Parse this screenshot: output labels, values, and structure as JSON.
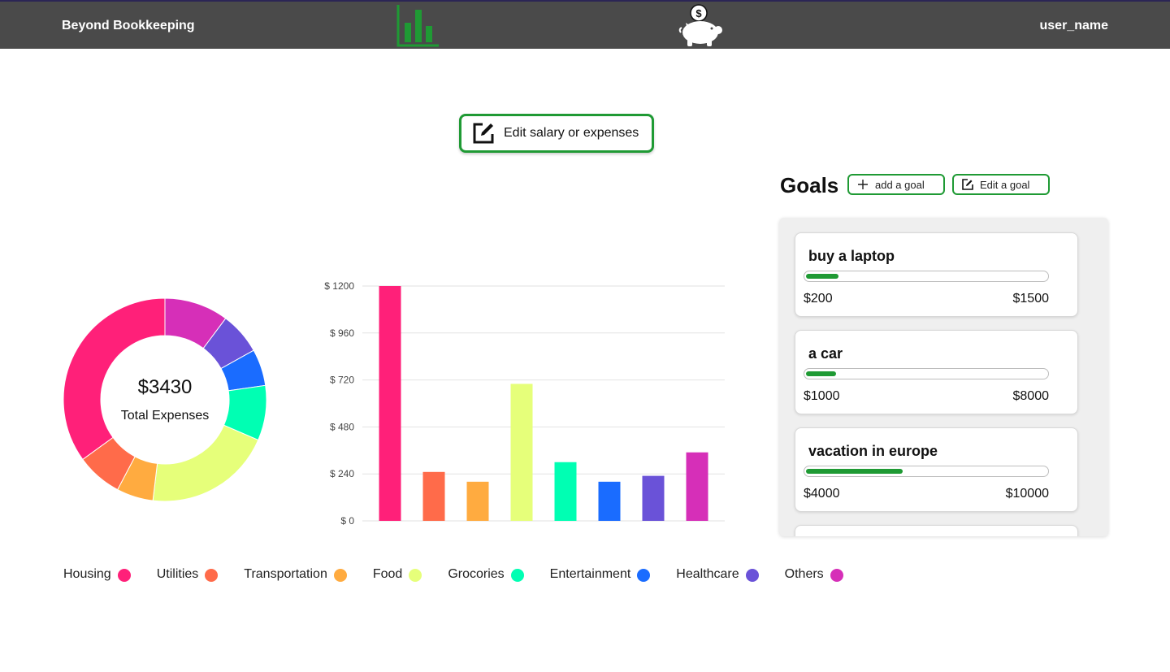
{
  "header": {
    "brand": "Beyond Bookkeeping",
    "user": "user_name",
    "nav_icons": [
      "bar-chart-icon",
      "piggy-bank-icon"
    ]
  },
  "edit_salary_button": {
    "label": "Edit salary or expenses",
    "icon": "edit-icon"
  },
  "donut": {
    "total": "$3430",
    "label": "Total Expenses"
  },
  "colors": {
    "accent": "#1f9a34",
    "header_bg": "#4a4a4a"
  },
  "chart_data": {
    "type": "bar",
    "categories": [
      "Housing",
      "Utilities",
      "Transportation",
      "Food",
      "Grocories",
      "Entertainment",
      "Healthcare",
      "Others"
    ],
    "values": [
      1200,
      250,
      200,
      700,
      300,
      200,
      230,
      350
    ],
    "colors": [
      "#ff2079",
      "#ff6b4a",
      "#ffab40",
      "#e6ff7a",
      "#00ffb3",
      "#1a6cff",
      "#6a52d8",
      "#d62fb8"
    ],
    "ylim": [
      0,
      1200
    ],
    "yticks": [
      "$ 0",
      "$ 240",
      "$ 480",
      "$ 720",
      "$ 960",
      "$ 1200"
    ],
    "ytick_values": [
      0,
      240,
      480,
      720,
      960,
      1200
    ],
    "grid": true,
    "title": "",
    "xlabel": "",
    "ylabel": ""
  },
  "goals": {
    "title": "Goals",
    "add_label": "add a goal",
    "edit_label": "Edit a goal",
    "items": [
      {
        "name": "buy a laptop",
        "current": "$200",
        "target": "$1500",
        "progress": 0.133
      },
      {
        "name": "a car",
        "current": "$1000",
        "target": "$8000",
        "progress": 0.125
      },
      {
        "name": "vacation in europe",
        "current": "$4000",
        "target": "$10000",
        "progress": 0.4
      },
      {
        "name": "",
        "current": "",
        "target": "",
        "progress": 0
      }
    ]
  }
}
